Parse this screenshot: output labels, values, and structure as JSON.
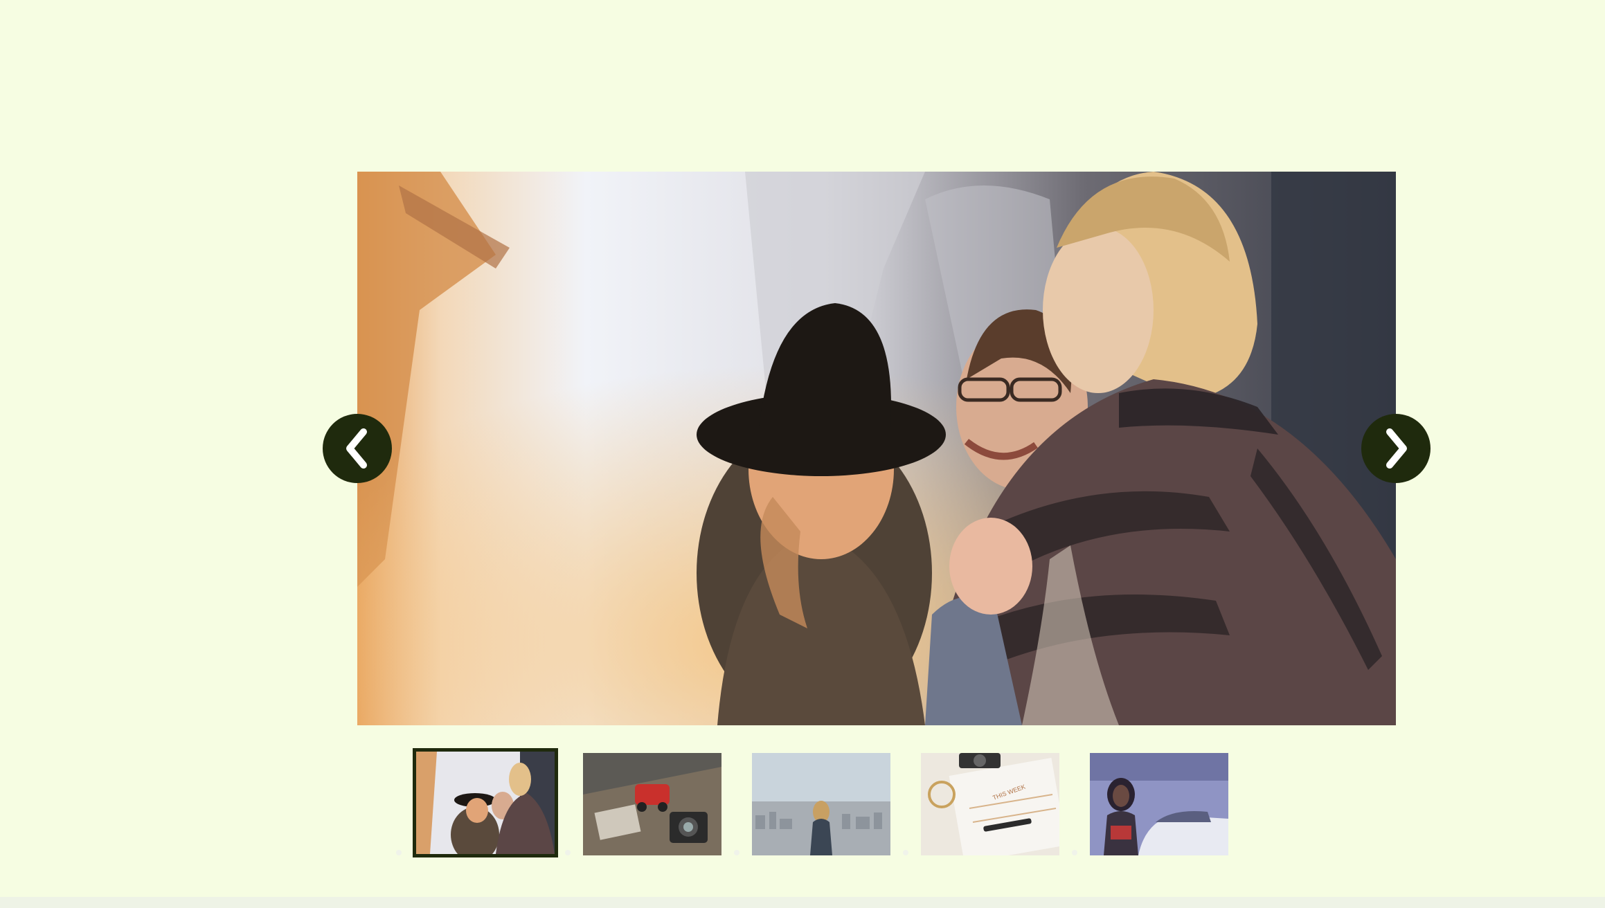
{
  "slider": {
    "colors": {
      "background": "#f6fde2",
      "control": "#1f2a0d",
      "control_icon": "#ffffff",
      "active_thumb_border": "#1f2a0d"
    },
    "prev_icon": "chevron-left-icon",
    "next_icon": "chevron-right-icon",
    "current_slide": 1,
    "slide_count": 5,
    "thumbnails": [
      {
        "name": "thumb-friends-laughing",
        "active": true
      },
      {
        "name": "thumb-toy-car-camera",
        "active": false
      },
      {
        "name": "thumb-woman-city-view",
        "active": false
      },
      {
        "name": "thumb-planner-desk",
        "active": false
      },
      {
        "name": "thumb-woman-parking",
        "active": false
      }
    ],
    "planner_text": "THIS WEEK"
  }
}
